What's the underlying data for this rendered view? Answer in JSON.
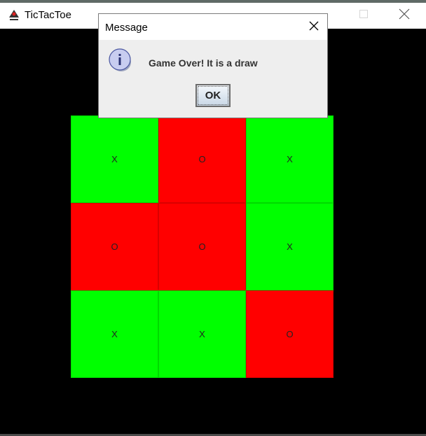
{
  "window": {
    "title": "TicTacToe",
    "icon": "java-duke-icon"
  },
  "board": {
    "cells": [
      {
        "mark": "X",
        "color": "#00ff00"
      },
      {
        "mark": "O",
        "color": "#ff0000"
      },
      {
        "mark": "X",
        "color": "#00ff00"
      },
      {
        "mark": "O",
        "color": "#ff0000"
      },
      {
        "mark": "O",
        "color": "#ff0000"
      },
      {
        "mark": "X",
        "color": "#00ff00"
      },
      {
        "mark": "X",
        "color": "#00ff00"
      },
      {
        "mark": "X",
        "color": "#00ff00"
      },
      {
        "mark": "O",
        "color": "#ff0000"
      }
    ]
  },
  "dialog": {
    "title": "Message",
    "message": "Game Over! It is a draw",
    "ok_label": "OK",
    "icon": "info-icon"
  }
}
